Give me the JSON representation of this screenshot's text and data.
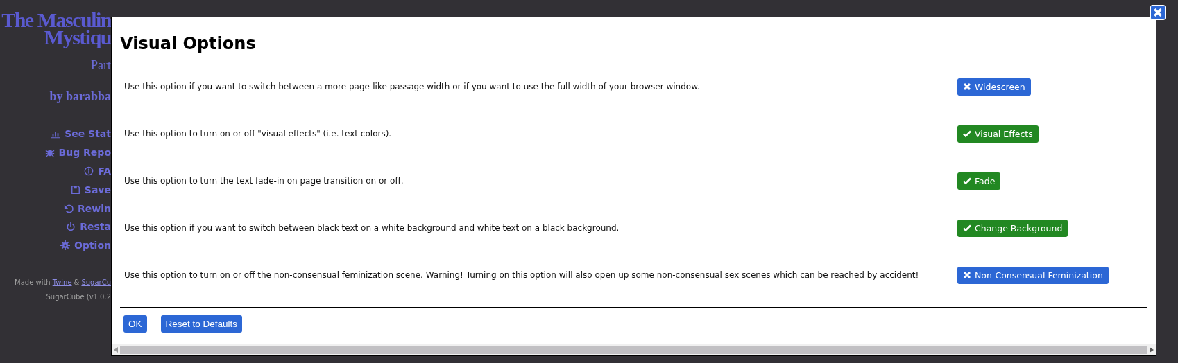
{
  "sidebar": {
    "title_lines": [
      "The Masculin",
      "Mystiqu"
    ],
    "subtitle": "Part",
    "author": "by barabba",
    "menu": [
      {
        "label": "See Stat"
      },
      {
        "label": "Bug Repo"
      },
      {
        "label": "FA"
      },
      {
        "label": "Save"
      },
      {
        "label": "Rewin"
      },
      {
        "label": "Resta"
      },
      {
        "label": "Option"
      }
    ],
    "credits": {
      "prefix": "Made with",
      "link_1": "Twine",
      "joiner": "&",
      "link_2": "SugarCu"
    },
    "version": "SugarCube (v1.0.2"
  },
  "dialog": {
    "title": "Visual Options",
    "options": [
      {
        "description": "Use this option if you want to switch between a more page-like passage width or if you want to use the full width of your browser window.",
        "button": "Widescreen",
        "on": false
      },
      {
        "description": "Use this option to turn on or off \"visual effects\" (i.e. text colors).",
        "button": "Visual Effects",
        "on": true
      },
      {
        "description": "Use this option to turn the text fade-in on page transition on or off.",
        "button": "Fade",
        "on": true
      },
      {
        "description": "Use this option if you want to switch between black text on a white background and white text on a black background.",
        "button": "Change Background",
        "on": true
      },
      {
        "description": "Use this option to turn on or off the non-consensual feminization scene. Warning! Turning on this option will also open up some non-consensual sex scenes which can be reached by accident!",
        "button": "Non-Consensual Feminization",
        "on": false
      }
    ],
    "footer_buttons": [
      "OK",
      "Reset to Defaults"
    ]
  }
}
